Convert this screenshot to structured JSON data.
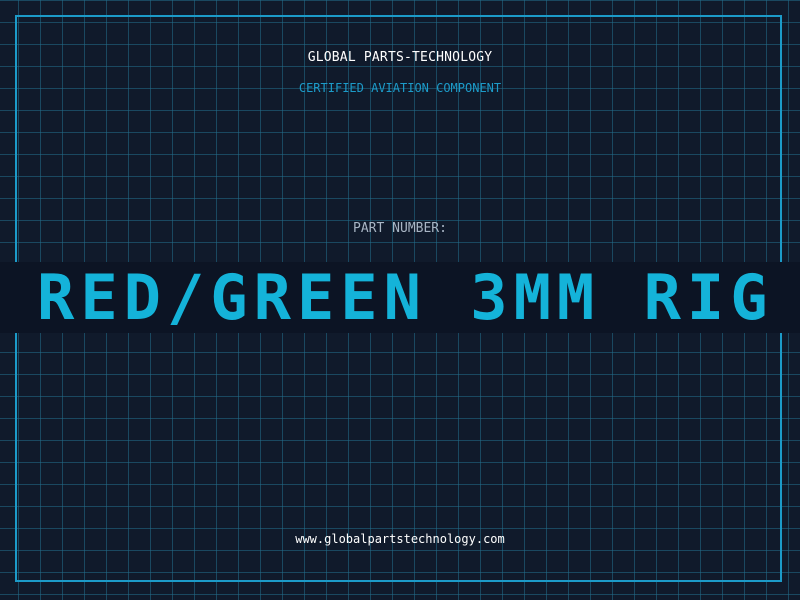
{
  "header": {
    "company": "GLOBAL PARTS-TECHNOLOGY",
    "subtitle": "CERTIFIED AVIATION COMPONENT"
  },
  "part": {
    "label": "PART NUMBER:",
    "value": "RED/GREEN 3MM RIG"
  },
  "footer": {
    "website": "www.globalpartstechnology.com"
  },
  "colors": {
    "background": "#101a2b",
    "grid": "#236e8c",
    "accent": "#1c9bc9",
    "part_number": "#14b3d9",
    "band": "#0c1424"
  }
}
